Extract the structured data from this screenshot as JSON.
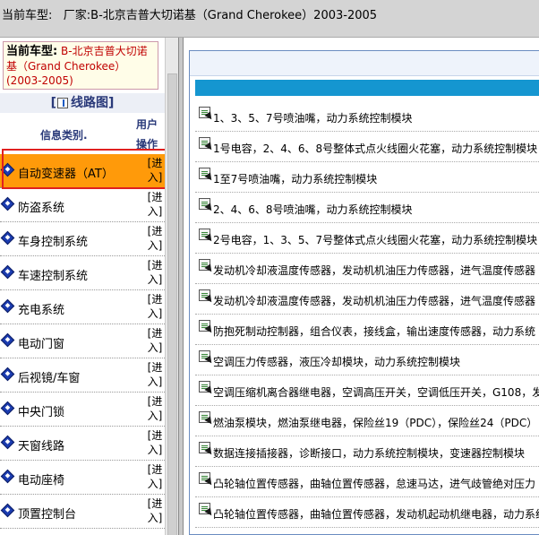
{
  "header": {
    "prefix": "当前车型:",
    "maker_model": "厂家:B-北京吉普大切诺基（Grand Cherokee）2003-2005"
  },
  "sidebar": {
    "current_label": "当前车型:",
    "current_model": "B-北京吉普大切诺基（Grand Cherokee）(2003-2005)",
    "diagram_title": "线路图",
    "col_category": "信息类别.",
    "col_ops": "用户操作",
    "go_label": "[进入]",
    "items": [
      {
        "label": "自动变速器（AT）",
        "active": true
      },
      {
        "label": "防盗系统",
        "active": false
      },
      {
        "label": "车身控制系统",
        "active": false
      },
      {
        "label": "车速控制系统",
        "active": false
      },
      {
        "label": "充电系统",
        "active": false
      },
      {
        "label": "电动门窗",
        "active": false
      },
      {
        "label": "后视镜/车窗",
        "active": false
      },
      {
        "label": "中央门锁",
        "active": false
      },
      {
        "label": "天窗线路",
        "active": false
      },
      {
        "label": "电动座椅",
        "active": false
      },
      {
        "label": "顶置控制台",
        "active": false
      }
    ]
  },
  "content": {
    "items": [
      "1、3、5、7号喷油嘴，动力系统控制模块",
      "1号电容，2、4、6、8号整体式点火线圈火花塞，动力系统控制模块",
      "1至7号喷油嘴，动力系统控制模块",
      "2、4、6、8号喷油嘴，动力系统控制模块",
      "2号电容，1、3、5、7号整体式点火线圈火花塞，动力系统控制模块",
      "发动机冷却液温度传感器，发动机机油压力传感器，进气温度传感器",
      "发动机冷却液温度传感器，发动机机油压力传感器，进气温度传感器",
      "防抱死制动控制器，组合仪表，接线盒，输出速度传感器，动力系统",
      "空调压力传感器，液压冷却模块，动力系统控制模块",
      "空调压缩机离合器继电器，空调高压开关，空调低压开关，G108，发",
      "燃油泵模块，燃油泵继电器，保险丝19（PDC），保险丝24（PDC）",
      "数据连接插接器，诊断接口，动力系统控制模块，变速器控制模块",
      "凸轮轴位置传感器，曲轴位置传感器，怠速马达，进气歧管绝对压力",
      "凸轮轴位置传感器，曲轴位置传感器，发动机起动机继电器，动力系统"
    ]
  }
}
